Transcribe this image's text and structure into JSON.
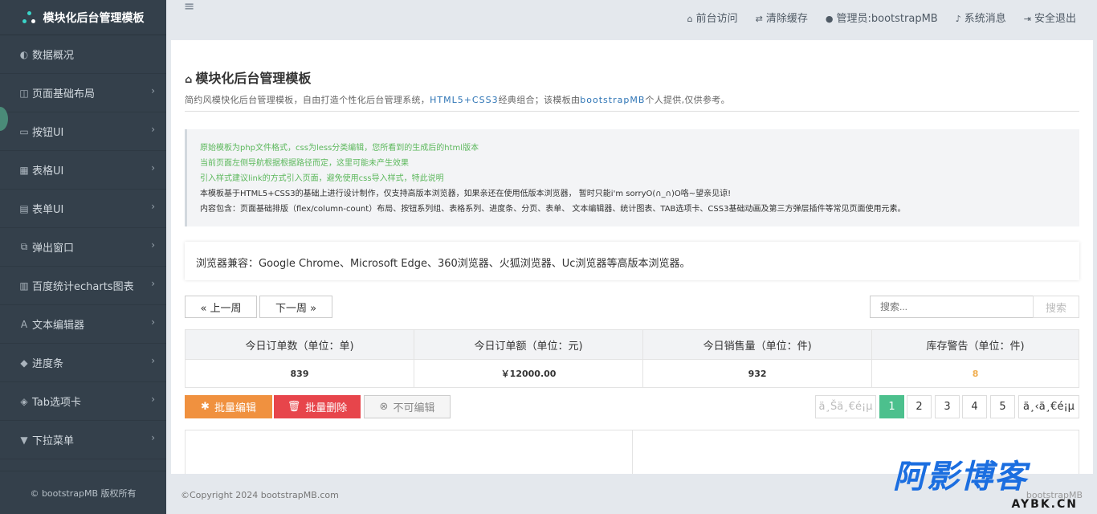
{
  "sidebar": {
    "brand": "模块化后台管理模板",
    "items": [
      {
        "icon": "dashboard-icon",
        "glyph": "◐",
        "label": "数据概况",
        "chevron": false
      },
      {
        "icon": "layout-icon",
        "glyph": "◫",
        "label": "页面基础布局",
        "chevron": true
      },
      {
        "icon": "button-icon",
        "glyph": "▭",
        "label": "按钮UI",
        "chevron": true
      },
      {
        "icon": "table-icon",
        "glyph": "▦",
        "label": "表格UI",
        "chevron": true
      },
      {
        "icon": "form-icon",
        "glyph": "▤",
        "label": "表单UI",
        "chevron": true
      },
      {
        "icon": "external-icon",
        "glyph": "⧉",
        "label": "弹出窗口",
        "chevron": true
      },
      {
        "icon": "chart-icon",
        "glyph": "▥",
        "label": "百度统计echarts图表",
        "chevron": true
      },
      {
        "icon": "font-icon",
        "glyph": "A",
        "label": "文本编辑器",
        "chevron": true
      },
      {
        "icon": "binoculars-icon",
        "glyph": "◆",
        "label": "进度条",
        "chevron": true
      },
      {
        "icon": "tags-icon",
        "glyph": "◈",
        "label": "Tab选项卡",
        "chevron": true
      },
      {
        "icon": "filter-icon",
        "glyph": "▼",
        "label": "下拉菜单",
        "chevron": true
      }
    ],
    "footer": "© bootstrapMB 版权所有"
  },
  "topbar": {
    "menu_glyph": "≡",
    "links": [
      {
        "icon": "home-icon",
        "glyph": "⌂",
        "label": "前台访问"
      },
      {
        "icon": "random-icon",
        "glyph": "⇄",
        "label": "清除缓存"
      },
      {
        "icon": "user-icon",
        "glyph": "●",
        "label": "管理员:bootstrapMB"
      },
      {
        "icon": "bell-icon",
        "glyph": "♪",
        "label": "系统消息"
      },
      {
        "icon": "logout-icon",
        "glyph": "⇥",
        "label": "安全退出"
      }
    ]
  },
  "page": {
    "title": "模块化后台管理模板",
    "subtitle_pre": "简约风模快化后台管理模板，自由打造个性化后台管理系统，",
    "subtitle_hl1": "HTML5+CSS3",
    "subtitle_mid": "经典组合；该模板由",
    "subtitle_hl2": "bootstrapMB",
    "subtitle_post": "个人提供,仅供参考。"
  },
  "notice": {
    "lines": [
      "原始模板为php文件格式，css为less分类编辑，您所看到的生成后的html版本",
      "当前页面左侧导航根据根据路径而定，这里可能未产生效果",
      "引入样式建议link的方式引入页面，避免使用css导入样式，特此说明",
      "本模板基于HTML5+CSS3的基础上进行设计制作，仅支持高版本浏览器，如果亲还在使用低版本浏览器， 暂时只能i'm sorryO(∩_∩)O咯~望亲见谅!",
      "内容包含：页面基础排版（flex/column-count）布局、按钮系列组、表格系列、进度条、分页、表单、 文本编辑器、统计图表、TAB选项卡、CSS3基础动画及第三方弹层插件等常见页面使用元素。"
    ]
  },
  "compat": "浏览器兼容：Google Chrome、Microsoft Edge、360浏览器、火狐浏览器、Uc浏览器等高版本浏览器。",
  "week_nav": {
    "prev": "« 上一周",
    "next": "下一周 »"
  },
  "search": {
    "placeholder": "搜索...",
    "button": "搜索"
  },
  "stats": {
    "headers": [
      "今日订单数（单位：单)",
      "今日订单额（单位：元)",
      "今日销售量（单位：件)",
      "库存警告（单位：件)"
    ],
    "values": [
      "839",
      "￥12000.00",
      "932",
      "8"
    ],
    "warn_color": "#f0ad4e"
  },
  "actions": {
    "batch_edit": "批量编辑",
    "batch_delete": "批量删除",
    "no_edit": "不可编辑"
  },
  "pagination": {
    "prev": "ä¸Šä¸€é¡µ",
    "pages": [
      "1",
      "2",
      "3",
      "4",
      "5"
    ],
    "active": "1",
    "next": "ä¸‹ä¸€é¡µ"
  },
  "footer": {
    "copyright": "©Copyright 2024 bootstrapMB.com",
    "right": "bootstrapMB"
  },
  "watermark": {
    "big": "阿影博客",
    "small": "AYBK.CN"
  },
  "colors": {
    "sidebar_bg": "#34404b",
    "accent_green": "#4cc08d",
    "orange": "#f0913f",
    "red": "#e7454b",
    "link_blue": "#2d74b5"
  }
}
